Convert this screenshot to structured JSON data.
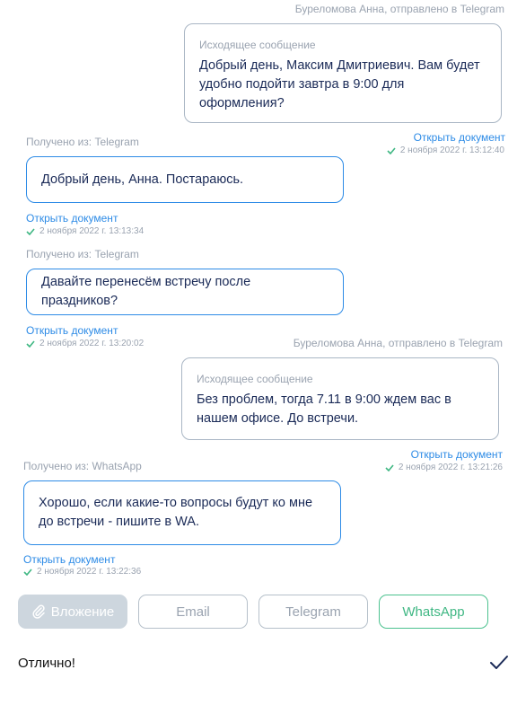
{
  "messages": [
    {
      "sender": "Буреломова Анна, отправлено в Telegram",
      "caption": "Исходящее сообщение",
      "text": "Добрый день, Максим Дмитриевич. Вам будет удобно подойти завтра в 9:00 для оформления?",
      "link": "Открыть документ",
      "time": "2 ноября 2022 г. 13:12:40"
    },
    {
      "source": "Получено из: Telegram",
      "text": "Добрый день, Анна. Постараюсь.",
      "link": "Открыть документ",
      "time": "2 ноября 2022 г. 13:13:34"
    },
    {
      "source": "Получено из: Telegram",
      "text": "Давайте перенесём встречу после праздников?",
      "link": "Открыть документ",
      "time": "2 ноября 2022 г. 13:20:02"
    },
    {
      "sender": "Буреломова Анна, отправлено в Telegram",
      "caption": "Исходящее сообщение",
      "text": "Без проблем, тогда 7.11 в 9:00 ждем вас в нашем офисе. До встречи.",
      "link": "Открыть документ",
      "time": "2 ноября 2022 г. 13:21:26"
    },
    {
      "source": "Получено из: WhatsApp",
      "text": "Хорошо, если какие-то вопросы будут ко мне до встречи - пишите в WA.",
      "link": "Открыть документ",
      "time": "2 ноября 2022 г. 13:22:36"
    }
  ],
  "channels": {
    "attach": "Вложение",
    "email": "Email",
    "telegram": "Telegram",
    "whatsapp": "WhatsApp"
  },
  "composer": {
    "value": "Отлично!"
  },
  "icons": {
    "status": "check-icon",
    "attach": "paperclip-icon",
    "send": "send-check-icon"
  },
  "colors": {
    "accent": "#2d8be6",
    "incoming_border": "#2d8be6",
    "whatsapp": "#3fb783",
    "status_check": "#3fb783",
    "text": "#1a2a57",
    "muted": "#9aa3b0"
  }
}
